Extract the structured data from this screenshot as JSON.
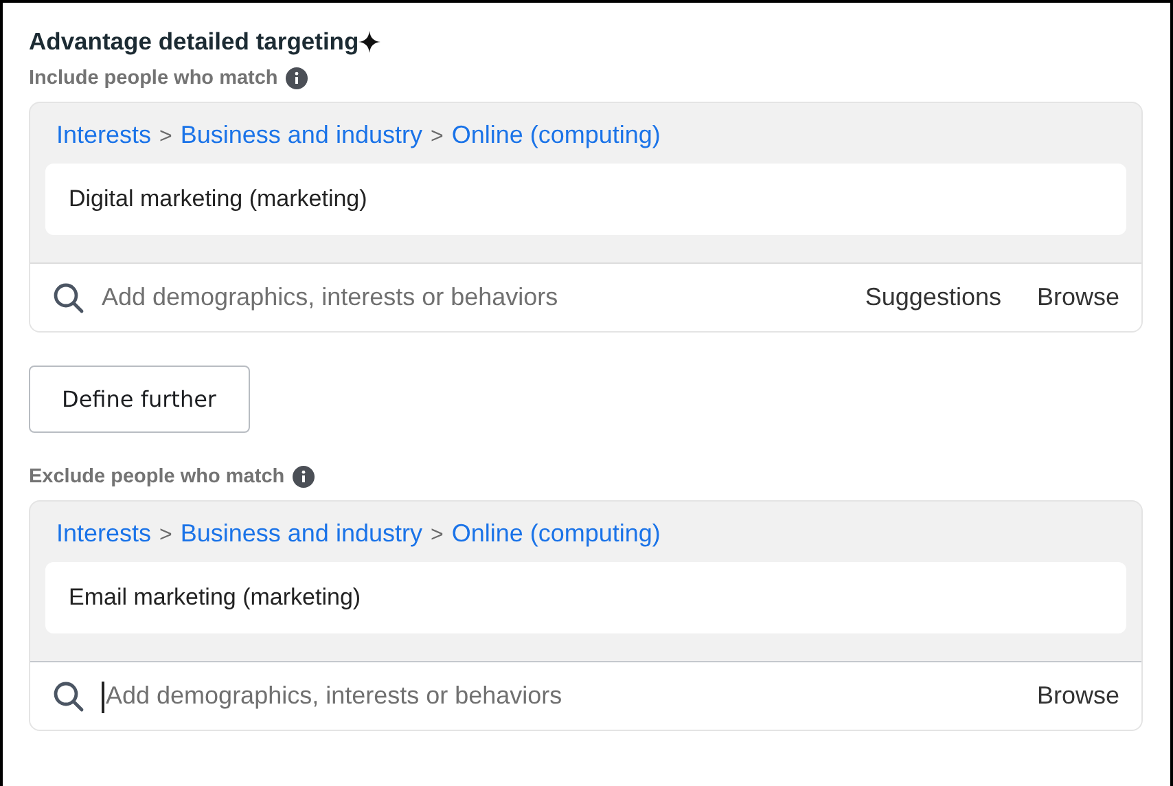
{
  "title": "Advantage detailed targeting",
  "sections": [
    {
      "label": "Include people who match",
      "separator": ">",
      "path": [
        "Interests",
        "Business and industry",
        "Online (computing)"
      ],
      "items": [
        "Digital marketing (marketing)"
      ],
      "search": {
        "placeholder": "Add demographics, interests or behaviors",
        "focused": false
      },
      "actions": [
        "Suggestions",
        "Browse"
      ],
      "button": "Define further"
    },
    {
      "label": "Exclude people who match",
      "separator": ">",
      "path": [
        "Interests",
        "Business and industry",
        "Online (computing)"
      ],
      "items": [
        "Email marketing (marketing)"
      ],
      "search": {
        "placeholder": "Add demographics, interests or behaviors",
        "focused": true
      },
      "actions": [
        "Browse"
      ]
    }
  ]
}
